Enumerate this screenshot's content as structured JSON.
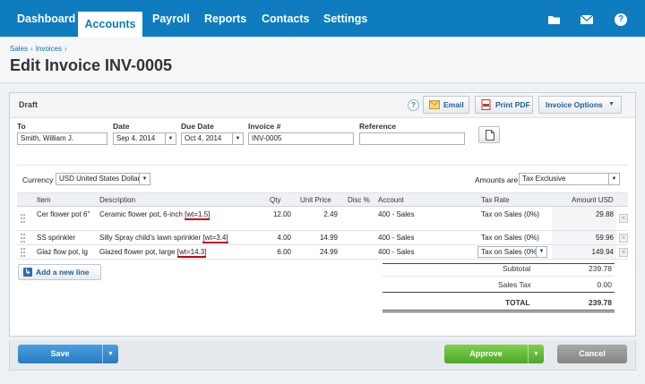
{
  "nav": {
    "tabs": [
      "Dashboard",
      "Accounts",
      "Payroll",
      "Reports",
      "Contacts",
      "Settings"
    ],
    "active": "Accounts",
    "icons": [
      "folder-icon",
      "mail-icon",
      "help-icon"
    ]
  },
  "breadcrumb": [
    "Sales",
    "Invoices"
  ],
  "page_title": "Edit Invoice INV-0005",
  "status": "Draft",
  "toolbar": {
    "help_glyph": "?",
    "email_label": "Email",
    "print_label": "Print PDF",
    "options_label": "Invoice Options"
  },
  "fields": {
    "to_label": "To",
    "to_value": "Smith, William J.",
    "date_label": "Date",
    "date_value": "Sep 4, 2014",
    "due_label": "Due Date",
    "due_value": "Oct 4, 2014",
    "invoice_label": "Invoice #",
    "invoice_value": "INV-0005",
    "reference_label": "Reference",
    "reference_value": "",
    "currency_label": "Currency",
    "currency_value": "USD United States Dollar",
    "amounts_label": "Amounts are",
    "amounts_value": "Tax Exclusive"
  },
  "table": {
    "headers": [
      "Item",
      "Description",
      "Qty",
      "Unit Price",
      "Disc %",
      "Account",
      "Tax Rate",
      "Amount USD"
    ],
    "rows": [
      {
        "item": "Cer flower pot 6\"",
        "description": "Ceramic flower pot, 6-inch",
        "tag": "[wt=1.5]",
        "qty": "12.00",
        "unit_price": "2.49",
        "disc": "",
        "account": "400 - Sales",
        "tax_rate": "Tax on Sales (0%)",
        "amount": "29.88"
      },
      {
        "item": "SS sprinkler",
        "description": "Silly Spray child's lawn sprinkler",
        "tag": "[wt=3.4]",
        "qty": "4.00",
        "unit_price": "14.99",
        "disc": "",
        "account": "400 - Sales",
        "tax_rate": "Tax on Sales (0%)",
        "amount": "59.96"
      },
      {
        "item": "Glaz flow pot, lg",
        "description": "Glazed flower pot, large",
        "tag": "[wt=14.3]",
        "qty": "6.00",
        "unit_price": "24.99",
        "disc": "",
        "account": "400 - Sales",
        "tax_rate": "Tax on Sales (0%",
        "amount": "149.94"
      }
    ],
    "highlight_color": "#cc0000"
  },
  "add_line_label": "Add a new line",
  "totals": {
    "subtotal_label": "Subtotal",
    "subtotal_value": "239.78",
    "tax_label": "Sales Tax",
    "tax_value": "0.00",
    "total_label": "TOTAL",
    "total_value": "239.78"
  },
  "actions": {
    "save_label": "Save",
    "approve_label": "Approve",
    "cancel_label": "Cancel",
    "save_color": "#2f86c9",
    "approve_color": "#5cb531",
    "cancel_color": "#8e8e8e"
  },
  "accent_color": "#0e7cbf"
}
